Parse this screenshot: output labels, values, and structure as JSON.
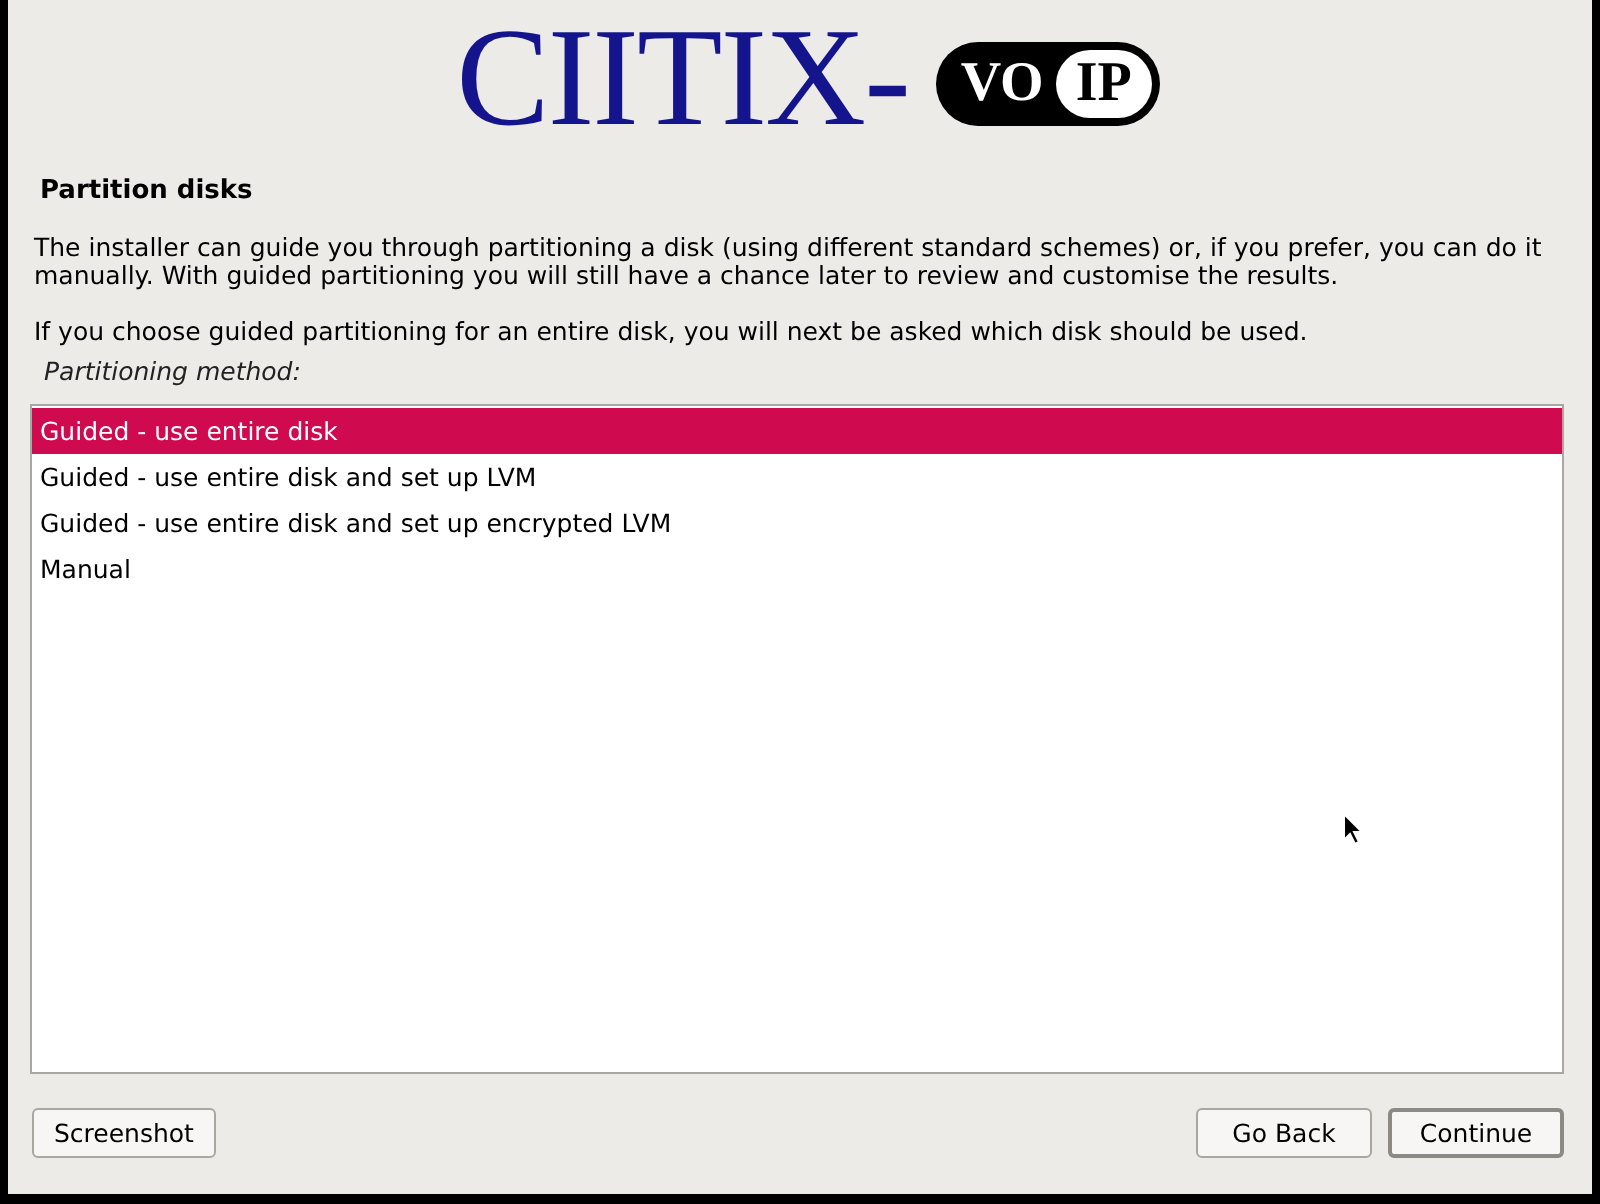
{
  "logo": {
    "text": "CIITIX-",
    "badge_left": "VO",
    "badge_right": "IP"
  },
  "title": "Partition disks",
  "paragraphs": [
    "The installer can guide you through partitioning a disk (using different standard schemes) or, if you prefer, you can do it manually. With guided partitioning you will still have a chance later to review and customise the results.",
    "If you choose guided partitioning for an entire disk, you will next be asked which disk should be used."
  ],
  "list_label": "Partitioning method:",
  "options": [
    {
      "label": "Guided - use entire disk",
      "selected": true
    },
    {
      "label": "Guided - use entire disk and set up LVM",
      "selected": false
    },
    {
      "label": "Guided - use entire disk and set up encrypted LVM",
      "selected": false
    },
    {
      "label": "Manual",
      "selected": false
    }
  ],
  "buttons": [
    {
      "label": "Screenshot",
      "kind": "left"
    },
    {
      "label": "Go Back",
      "kind": "right"
    },
    {
      "label": "Continue",
      "kind": "default"
    }
  ]
}
